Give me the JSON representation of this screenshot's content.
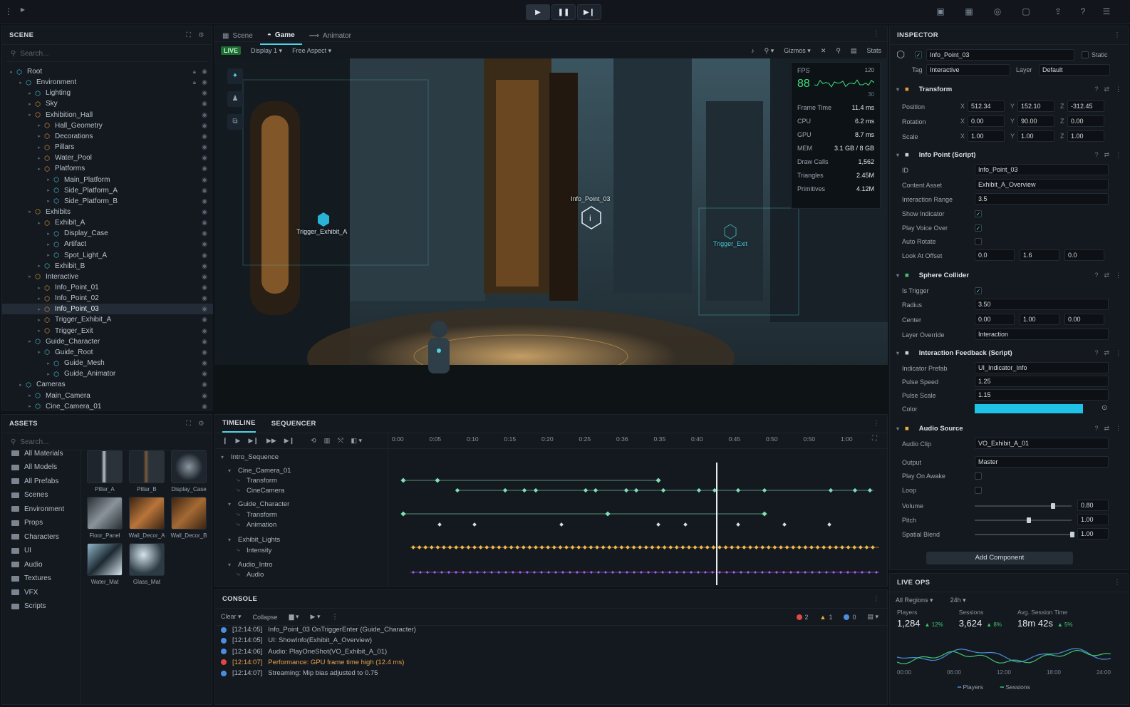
{
  "top": {
    "play_icon": "play-icon",
    "pause_icon": "pause-icon",
    "step_icon": "step-icon"
  },
  "scene": {
    "title": "SCENE",
    "search_placeholder": "Search...",
    "tree": [
      {
        "label": "Root",
        "depth": 0,
        "icon": "cube",
        "lock": true
      },
      {
        "label": "Environment",
        "depth": 1,
        "icon": "cube",
        "lock": true
      },
      {
        "label": "Lighting",
        "depth": 2,
        "icon": "cube"
      },
      {
        "label": "Sky",
        "depth": 2,
        "icon": "prefab"
      },
      {
        "label": "Exhibition_Hall",
        "depth": 2,
        "icon": "prefab"
      },
      {
        "label": "Hall_Geometry",
        "depth": 3,
        "icon": "prefab"
      },
      {
        "label": "Decorations",
        "depth": 3,
        "icon": "prefab"
      },
      {
        "label": "Pillars",
        "depth": 3,
        "icon": "prefab"
      },
      {
        "label": "Water_Pool",
        "depth": 3,
        "icon": "prefab"
      },
      {
        "label": "Platforms",
        "depth": 3,
        "icon": "prefab"
      },
      {
        "label": "Main_Platform",
        "depth": 4,
        "icon": "cube"
      },
      {
        "label": "Side_Platform_A",
        "depth": 4,
        "icon": "cube"
      },
      {
        "label": "Side_Platform_B",
        "depth": 4,
        "icon": "cube"
      },
      {
        "label": "Exhibits",
        "depth": 2,
        "icon": "prefab"
      },
      {
        "label": "Exhibit_A",
        "depth": 3,
        "icon": "prefab"
      },
      {
        "label": "Display_Case",
        "depth": 4,
        "icon": "cube"
      },
      {
        "label": "Artifact",
        "depth": 4,
        "icon": "cube"
      },
      {
        "label": "Spot_Light_A",
        "depth": 4,
        "icon": "cube"
      },
      {
        "label": "Exhibit_B",
        "depth": 3,
        "icon": "cube"
      },
      {
        "label": "Interactive",
        "depth": 2,
        "icon": "prefab"
      },
      {
        "label": "Info_Point_01",
        "depth": 3,
        "icon": "prefab"
      },
      {
        "label": "Info_Point_02",
        "depth": 3,
        "icon": "prefab"
      },
      {
        "label": "Info_Point_03",
        "depth": 3,
        "icon": "prefab",
        "selected": true
      },
      {
        "label": "Trigger_Exhibit_A",
        "depth": 3,
        "icon": "prefab"
      },
      {
        "label": "Trigger_Exit",
        "depth": 3,
        "icon": "prefab"
      },
      {
        "label": "Guide_Character",
        "depth": 2,
        "icon": "cube"
      },
      {
        "label": "Guide_Root",
        "depth": 3,
        "icon": "cube"
      },
      {
        "label": "Guide_Mesh",
        "depth": 4,
        "icon": "cube"
      },
      {
        "label": "Guide_Animator",
        "depth": 4,
        "icon": "cube"
      },
      {
        "label": "Cameras",
        "depth": 1,
        "icon": "cube"
      },
      {
        "label": "Main_Camera",
        "depth": 2,
        "icon": "cube"
      },
      {
        "label": "Cine_Camera_01",
        "depth": 2,
        "icon": "cube"
      }
    ]
  },
  "assets": {
    "title": "ASSETS",
    "search_placeholder": "Search...",
    "folders": [
      "All Materials",
      "All Models",
      "All Prefabs",
      "Scenes",
      "Environment",
      "Props",
      "Characters",
      "UI",
      "Audio",
      "Textures",
      "VFX",
      "Scripts"
    ],
    "items": [
      "Pillar_A",
      "Pillar_B",
      "Display_Case",
      "Floor_Panel",
      "Wall_Decor_A",
      "Wall_Decor_B",
      "Water_Mat",
      "Glass_Mat"
    ]
  },
  "viewport": {
    "tabs": [
      "Scene",
      "Game",
      "Animator"
    ],
    "active_tab": "Game",
    "live": "LIVE",
    "display": "Display 1",
    "aspect": "Free Aspect",
    "gizmos": "Gizmos",
    "stats_label": "Stats",
    "labels": {
      "trigger_a": "Trigger_Exhibit_A",
      "info": "Info_Point_03",
      "trigger_exit": "Trigger_Exit"
    },
    "stats": {
      "fps_label": "FPS",
      "fps": "88",
      "fps_max": "120",
      "fps_min": "30",
      "rows": [
        [
          "Frame Time",
          "11.4 ms"
        ],
        [
          "CPU",
          "6.2 ms"
        ],
        [
          "GPU",
          "8.7 ms"
        ],
        [
          "MEM",
          "3.1 GB / 8 GB"
        ],
        [
          "Draw Calls",
          "1,562"
        ],
        [
          "Triangles",
          "2.45M"
        ],
        [
          "Primitives",
          "4.12M"
        ]
      ]
    }
  },
  "inspector": {
    "title": "INSPECTOR",
    "object_name": "Info_Point_03",
    "static": "Static",
    "tag_label": "Tag",
    "tag": "Interactive",
    "layer_label": "Layer",
    "layer": "Default",
    "transform": {
      "title": "Transform",
      "position_label": "Position",
      "rotation_label": "Rotation",
      "scale_label": "Scale",
      "position": [
        "512.34",
        "152.10",
        "-312.45"
      ],
      "rotation": [
        "0.00",
        "90.00",
        "0.00"
      ],
      "scale": [
        "1.00",
        "1.00",
        "1.00"
      ]
    },
    "info_point": {
      "title": "Info Point (Script)",
      "id_label": "ID",
      "id": "Info_Point_03",
      "content_label": "Content Asset",
      "content": "Exhibit_A_Overview",
      "range_label": "Interaction Range",
      "range": "3.5",
      "show_label": "Show Indicator",
      "voice_label": "Play Voice Over",
      "rotate_label": "Auto Rotate",
      "look_label": "Look At Offset",
      "look": [
        "0.0",
        "1.6",
        "0.0"
      ]
    },
    "sphere": {
      "title": "Sphere Collider",
      "trigger_label": "Is Trigger",
      "radius_label": "Radius",
      "radius": "3.50",
      "center_label": "Center",
      "center": [
        "0.00",
        "1.00",
        "0.00"
      ],
      "layer_label": "Layer Override",
      "layer": "Interaction"
    },
    "feedback": {
      "title": "Interaction Feedback (Script)",
      "prefab_label": "Indicator Prefab",
      "prefab": "UI_Indicator_Info",
      "speed_label": "Pulse Speed",
      "speed": "1.25",
      "scale_label": "Pulse Scale",
      "scale": "1.15",
      "color_label": "Color",
      "color": "#1fc3e8"
    },
    "audio": {
      "title": "Audio Source",
      "clip_label": "Audio Clip",
      "clip": "VO_Exhibit_A_01",
      "output_label": "Output",
      "output": "Master",
      "awake_label": "Play On Awake",
      "loop_label": "Loop",
      "volume_label": "Volume",
      "volume": "0.80",
      "pitch_label": "Pitch",
      "pitch": "1.00",
      "spatial_label": "Spatial Blend",
      "spatial": "1.00"
    },
    "add_component": "Add Component"
  },
  "liveops": {
    "title": "LIVE OPS",
    "region": "All Regions",
    "range": "24h",
    "kpis": [
      {
        "label": "Players",
        "value": "1,284",
        "delta": "12%"
      },
      {
        "label": "Sessions",
        "value": "3,624",
        "delta": "8%"
      },
      {
        "label": "Avg. Session Time",
        "value": "18m 42s",
        "delta": "5%"
      }
    ],
    "ticks": [
      "00:00",
      "06:00",
      "12:00",
      "18:00",
      "24:00"
    ],
    "legend": [
      "Players",
      "Sessions"
    ]
  },
  "timeline": {
    "tabs": [
      "TIMELINE",
      "SEQUENCER"
    ],
    "times": [
      "0:00",
      "0:05",
      "0:10",
      "0:15",
      "0:20",
      "0:25",
      "0:36",
      "0:35",
      "0:40",
      "0:45",
      "0:50",
      "0:50",
      "1:00"
    ],
    "rows": [
      "Intro_Sequence",
      "Cine_Camera_01",
      "Transform",
      "CineCamera",
      "Guide_Character",
      "Transform",
      "Animation",
      "Exhibit_Lights",
      "Intensity",
      "Audio_Intro",
      "Audio"
    ]
  },
  "console": {
    "title": "CONSOLE",
    "clear": "Clear",
    "collapse": "Collapse",
    "errors": "2",
    "warnings": "1",
    "infos": "0",
    "lines": [
      {
        "type": "info",
        "time": "[12:14:05]",
        "text": "Info_Point_03 OnTriggerEnter (Guide_Character)"
      },
      {
        "type": "info",
        "time": "[12:14:05]",
        "text": "UI: ShowInfo(Exhibit_A_Overview)"
      },
      {
        "type": "info",
        "time": "[12:14:06]",
        "text": "Audio: PlayOneShot(VO_Exhibit_A_01)"
      },
      {
        "type": "error",
        "time": "[12:14:07]",
        "text": "Performance: GPU frame time high (12.4 ms)"
      },
      {
        "type": "info",
        "time": "[12:14:07]",
        "text": "Streaming: Mip bias adjusted to 0.75"
      }
    ]
  },
  "colors": {
    "accent": "#4fd3e6",
    "keyframe_green": "#7fe0b4",
    "keyframe_yellow": "#f0b84a",
    "keyframe_purple": "#a35de8",
    "error": "#e04848",
    "warning": "#e8b23a"
  }
}
